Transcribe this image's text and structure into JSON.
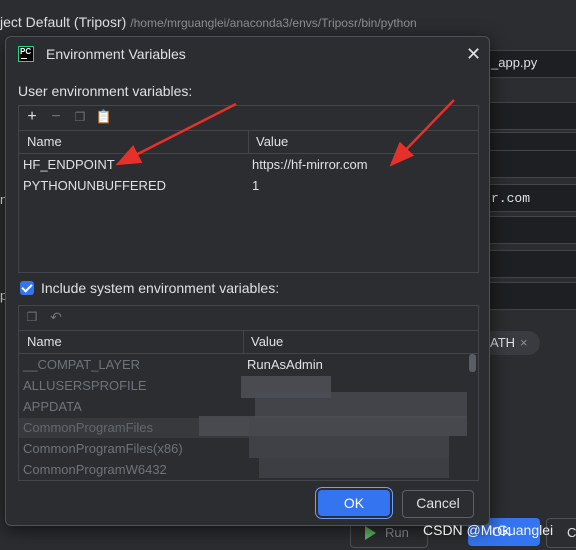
{
  "background": {
    "title": "ject Default (Triposr)",
    "path": "/home/mrguanglei/anaconda3/envs/Triposr/bin/python",
    "file": "_app.py",
    "partial_text": "r.com",
    "chip_text": "ATH",
    "chip_close": "×",
    "run_label": "Run",
    "ok_label": "OK",
    "cancel_partial": "C",
    "left_letters": [
      "n",
      "p",
      "y"
    ]
  },
  "dialog": {
    "title": "Environment Variables",
    "icon_text": "PC",
    "user_section_label": "User environment variables:",
    "user_table": {
      "headers": [
        "Name",
        "Value"
      ],
      "rows": [
        {
          "name": "HF_ENDPOINT",
          "value": "https://hf-mirror.com"
        },
        {
          "name": "PYTHONUNBUFFERED",
          "value": "1"
        }
      ]
    },
    "include_system_label": "Include system environment variables:",
    "include_system_checked": true,
    "system_table": {
      "headers": [
        "Name",
        "Value"
      ],
      "rows": [
        {
          "name": "__COMPAT_LAYER",
          "value": "RunAsAdmin"
        },
        {
          "name": "ALLUSERSPROFILE",
          "value": ""
        },
        {
          "name": "APPDATA",
          "value": ""
        },
        {
          "name": "CommonProgramFiles",
          "value": ""
        },
        {
          "name": "CommonProgramFiles(x86)",
          "value": ""
        },
        {
          "name": "CommonProgramW6432",
          "value": ""
        }
      ]
    },
    "ok_label": "OK",
    "cancel_label": "Cancel"
  },
  "watermark": "CSDN @MrGuanglei",
  "colors": {
    "accent": "#3574f0",
    "arrow": "#e5312a",
    "background": "#2b2d30"
  }
}
